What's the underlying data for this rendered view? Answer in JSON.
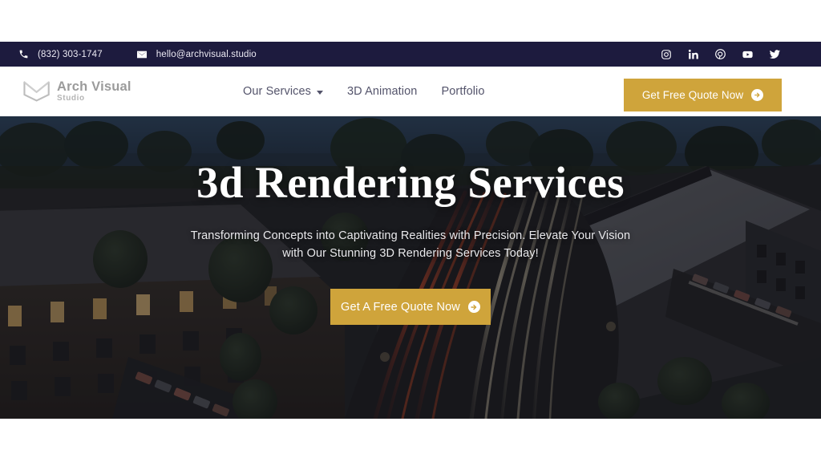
{
  "topbar": {
    "phone": "(832) 303-1747",
    "phone_icon": "phone-icon",
    "email": "hello@archvisual.studio",
    "email_icon": "envelope-icon",
    "socials": [
      {
        "name": "instagram-icon",
        "label": "Instagram"
      },
      {
        "name": "linkedin-icon",
        "label": "LinkedIn"
      },
      {
        "name": "pinterest-icon",
        "label": "Pinterest"
      },
      {
        "name": "youtube-icon",
        "label": "YouTube"
      },
      {
        "name": "twitter-icon",
        "label": "Twitter"
      }
    ],
    "background_color": "#1d1b3e"
  },
  "header": {
    "logo": {
      "name": "Arch Visual",
      "sub": "Studio",
      "mark_icon": "arch-visual-butterfly-mark-icon"
    },
    "nav": [
      {
        "label": "Our Services",
        "has_dropdown": true
      },
      {
        "label": "3D Animation",
        "has_dropdown": false
      },
      {
        "label": "Portfolio",
        "has_dropdown": false
      }
    ],
    "cta_label": "Get Free Quote Now",
    "cta_icon": "arrow-right-circle-icon",
    "cta_color": "#cfa43b"
  },
  "hero": {
    "title": "3d Rendering Services",
    "subtitle": "Transforming Concepts into Captivating Realities with Precision. Elevate Your Vision with Our Stunning 3D Rendering Services Today!",
    "cta_label": "Get A Free Quote Now",
    "cta_icon": "arrow-right-circle-icon",
    "cta_color": "#cfa43b",
    "background_description": "aerial dusk rendering of campus buildings with curved highway light trails"
  }
}
